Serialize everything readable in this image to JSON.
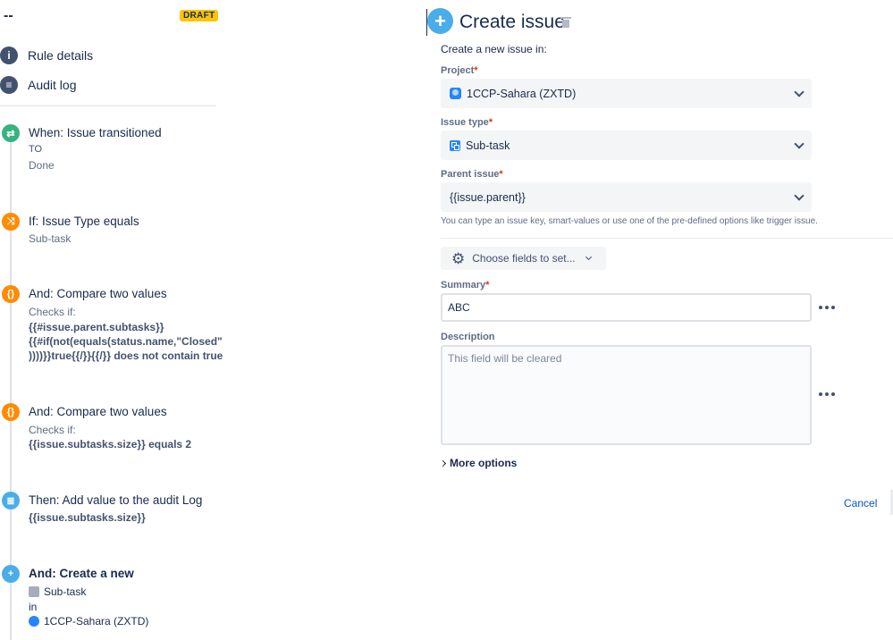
{
  "rule": {
    "name": "--",
    "status_badge": "DRAFT"
  },
  "nav": {
    "rule_details": "Rule details",
    "audit_log": "Audit log"
  },
  "steps": {
    "trigger": {
      "title": "When: Issue transitioned",
      "to_label": "TO",
      "to_value": "Done"
    },
    "condition": {
      "title": "If: Issue Type equals",
      "value": "Sub-task"
    },
    "compare1": {
      "title": "And: Compare two values",
      "checks_label": "Checks if:",
      "line1": "{{#issue.parent.subtasks}}",
      "line2": "{{#if(not(equals(status.name,\"Closed\"",
      "line3": "))))}}true{{/}}{{/}} does not contain true"
    },
    "compare2": {
      "title": "And: Compare two values",
      "checks_label": "Checks if:",
      "line1": "{{issue.subtasks.size}} equals 2"
    },
    "audit": {
      "title": "Then: Add value to the audit Log",
      "value": "{{issue.subtasks.size}}"
    },
    "create": {
      "title": "And: Create a new",
      "issue_type": "Sub-task",
      "in_label": "in",
      "project": "1CCP-Sahara (ZXTD)"
    }
  },
  "form": {
    "title": "Create issue",
    "create_in": "Create a new issue in:",
    "project_label": "Project",
    "project_value": "1CCP-Sahara (ZXTD)",
    "issue_type_label": "Issue type",
    "issue_type_value": "Sub-task",
    "parent_label": "Parent issue",
    "parent_value": "{{issue.parent}}",
    "help_text": "You can type an issue key, smart-values or use one of the pre-defined options like trigger issue.",
    "choose_fields": "Choose fields to set...",
    "summary_label": "Summary",
    "summary_value": "ABC",
    "description_label": "Description",
    "description_placeholder": "This field will be cleared",
    "more_options": "More options",
    "cancel": "Cancel",
    "required_marker": "*"
  },
  "colors": {
    "draft_badge": "#ffc400",
    "trigger": "#36b37e",
    "condition": "#ff8b00",
    "action": "#4bade8",
    "link": "#0052cc"
  }
}
